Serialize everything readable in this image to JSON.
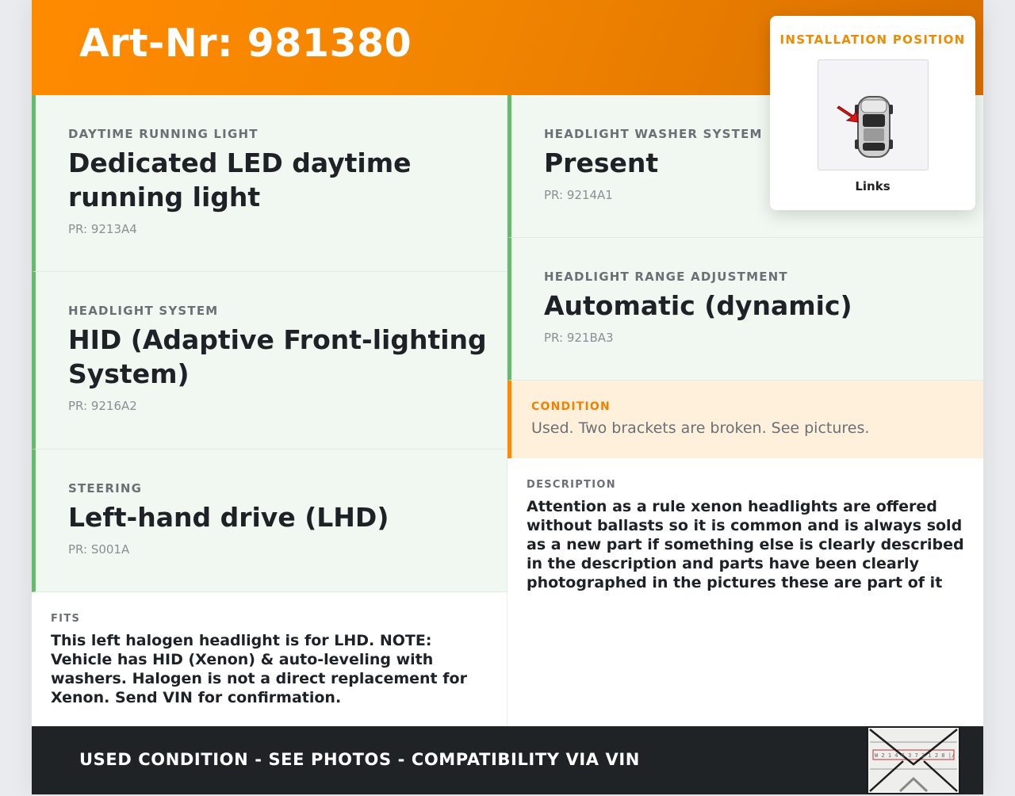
{
  "header": {
    "title": "Art-Nr: 981380"
  },
  "install_position": {
    "label": "INSTALLATION POSITION",
    "caption": "Links",
    "image_icon": "car-top-view-icon"
  },
  "specs_left": [
    {
      "label": "DAYTIME RUNNING LIGHT",
      "value": "Dedicated LED daytime running light",
      "pr": "PR: 9213A4"
    },
    {
      "label": "HEADLIGHT SYSTEM",
      "value": "HID (Adaptive Front-lighting System)",
      "pr": "PR: 9216A2"
    },
    {
      "label": "STEERING",
      "value": "Left-hand drive (LHD)",
      "pr": "PR: S001A"
    }
  ],
  "specs_right": [
    {
      "label": "HEADLIGHT WASHER SYSTEM",
      "value": "Present",
      "pr": "PR: 9214A1"
    },
    {
      "label": "HEADLIGHT RANGE ADJUSTMENT",
      "value": "Automatic (dynamic)",
      "pr": "PR: 921BA3"
    }
  ],
  "condition": {
    "label": "CONDITION",
    "text": "Used. Two brackets are broken. See pictures."
  },
  "fits": {
    "label": "FITS",
    "text": "This left halogen headlight is for LHD. NOTE: Vehicle has HID (Xenon) & auto-leveling with washers. Halogen is not a direct replacement for Xenon. Send VIN for confirmation."
  },
  "description": {
    "label": "DESCRIPTION",
    "text": "Attention as a rule xenon headlights are offered without ballasts so it is common and is always sold as a new part if something else is clearly described in the description and parts have been clearly photographed in the pictures these are part of it"
  },
  "footer": {
    "text": "USED CONDITION - SEE PHOTOS - COMPATIBILITY VIA VIN",
    "stamp_icon": "envelope-stamp-icon",
    "stamp_text": "W 2 1 4 6 3 7 3 1 2 8   |/ A... Merc...-Benz"
  },
  "colors": {
    "accent": "#ff8a00",
    "green": "#66bb6a",
    "dark": "#202326",
    "spec_bg": "#f1f8f1",
    "condition_bg": "#fff0dc"
  }
}
